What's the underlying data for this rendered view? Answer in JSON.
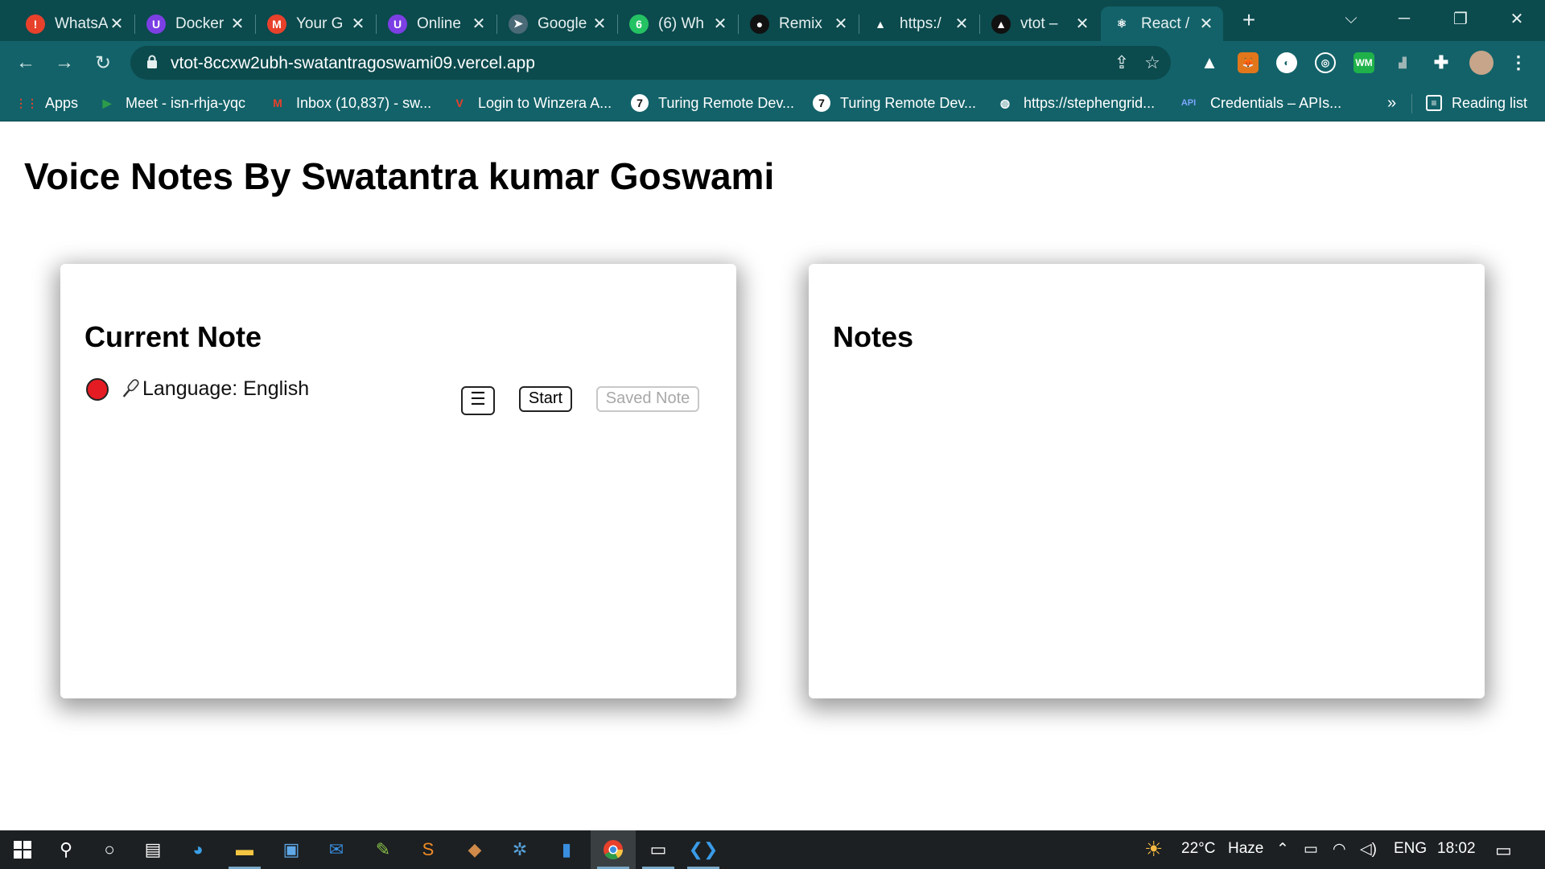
{
  "browser": {
    "tabs": [
      {
        "title": "WhatsApp",
        "favicon": "alert-icon",
        "color": "#e8412b",
        "glyph": "!"
      },
      {
        "title": "Docker",
        "favicon": "u-icon",
        "color": "#7b3fe4",
        "glyph": "U"
      },
      {
        "title": "Your G",
        "favicon": "gmail-icon",
        "color": "#e8412b",
        "glyph": "M"
      },
      {
        "title": "Online",
        "favicon": "u-icon",
        "color": "#7b3fe4",
        "glyph": "U"
      },
      {
        "title": "Google",
        "favicon": "send-icon",
        "color": "#4a6a78",
        "glyph": "➤"
      },
      {
        "title": "(6) Wh",
        "favicon": "whatsapp-icon",
        "color": "#25c263",
        "glyph": "6"
      },
      {
        "title": "Remix",
        "favicon": "remix-icon",
        "color": "#111111",
        "glyph": "●"
      },
      {
        "title": "https:/",
        "favicon": "triangle-icon",
        "color": "#0b4a4d",
        "glyph": "▲"
      },
      {
        "title": "vtot –",
        "favicon": "vercel-icon",
        "color": "#111111",
        "glyph": "▲"
      },
      {
        "title": "React /",
        "favicon": "react-icon",
        "color": "#136269",
        "glyph": "⚛"
      }
    ],
    "new_tab_glyph": "+",
    "tab_close_glyph": "✕",
    "url": "vtot-8ccxw2ubh-swatantragoswami09.vercel.app",
    "bookmarks": [
      {
        "label": "Apps",
        "icon": "apps-grid-icon",
        "color": "#e8412b",
        "glyph": "⋮⋮"
      },
      {
        "label": "Meet - isn-rhja-yqc",
        "icon": "meet-icon",
        "color": "#2d9c4a",
        "glyph": "▶"
      },
      {
        "label": "Inbox (10,837) - sw...",
        "icon": "gmail-icon",
        "color": "#e8412b",
        "glyph": "M"
      },
      {
        "label": "Login to Winzera A...",
        "icon": "winzera-icon",
        "color": "#e8412b",
        "glyph": "V"
      },
      {
        "label": "Turing Remote Dev...",
        "icon": "turing-icon",
        "color": "#111111",
        "glyph": "7"
      },
      {
        "label": "Turing Remote Dev...",
        "icon": "turing-icon",
        "color": "#111111",
        "glyph": "7"
      },
      {
        "label": "https://stephengrid...",
        "icon": "globe-icon",
        "color": "#ffffff",
        "glyph": "◍"
      },
      {
        "label": "Credentials – APIs...",
        "icon": "api-icon",
        "color": "#7ea6ff",
        "glyph": "API"
      }
    ],
    "bookmarks_overflow": "»",
    "reading_list": "Reading list"
  },
  "page": {
    "title": "Voice Notes By Swatantra kumar Goswami",
    "current_note": {
      "heading": "Current Note",
      "language_label": "Language: English",
      "menu_glyph": "☰",
      "start_label": "Start",
      "save_label": "Saved Note"
    },
    "notes": {
      "heading": "Notes"
    }
  },
  "taskbar": {
    "weather": "22°C",
    "weather_desc": "Haze",
    "language": "ENG",
    "time": "18:02"
  },
  "colors": {
    "chrome_dark": "#0b4a4d",
    "chrome_mid": "#136269",
    "record": "#e51b23"
  }
}
